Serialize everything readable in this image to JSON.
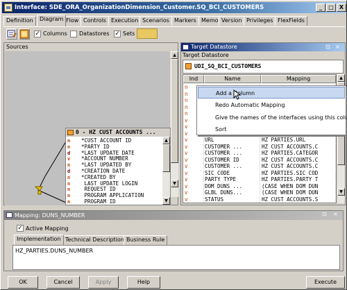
{
  "window": {
    "title": "Interface: SDE_ORA_OrganizationDimension_Customer.SQ_BCI_CUSTOMERS",
    "minimize_icon": "_",
    "maximize_icon": "□",
    "close_icon": "X"
  },
  "tabs": [
    "Definition",
    "Diagram",
    "Flow",
    "Controls",
    "Execution",
    "Scenarios",
    "Markers",
    "Memo",
    "Version",
    "Privileges",
    "FlexFields"
  ],
  "toolbar": {
    "columns_label": "Columns",
    "columns_checked": "✓",
    "datastores_label": "Datastores",
    "sets_label": "Sets",
    "sets_checked": "✓"
  },
  "sources": {
    "title": "Sources",
    "datastore_title": "0 - HZ CUST ACCOUNTS ...",
    "columns": [
      {
        "key": "n",
        "name": "*CUST ACCOUNT ID"
      },
      {
        "key": "n",
        "name": "*PARTY ID"
      },
      {
        "key": "d",
        "name": "*LAST UPDATE DATE"
      },
      {
        "key": "v",
        "name": "*ACCOUNT NUMBER"
      },
      {
        "key": "n",
        "name": "*LAST UPDATED BY"
      },
      {
        "key": "d",
        "name": "*CREATION DATE"
      },
      {
        "key": "n",
        "name": "*CREATED BY"
      },
      {
        "key": "n",
        "name": " LAST UPDATE LOGIN"
      },
      {
        "key": "n",
        "name": " REQUEST ID"
      },
      {
        "key": "n",
        "name": " PROGRAM APPLICATION"
      },
      {
        "key": "n",
        "name": " PROGRAM ID"
      }
    ]
  },
  "target": {
    "panel_title": "Target Datastore",
    "subtitle": "Target Datastore",
    "datastore_name": "UDI_SQ_BCI_CUSTOMERS",
    "headers": [
      "Ind",
      "Name",
      "Mapping"
    ],
    "rows": [
      {
        "ind": "n",
        "name": "",
        "mapping": ""
      },
      {
        "ind": "n",
        "name": "",
        "mapping": ""
      },
      {
        "ind": "n",
        "name": "",
        "mapping": ""
      },
      {
        "ind": "n",
        "name": "",
        "mapping": ""
      },
      {
        "ind": "n",
        "name": "",
        "mapping": ""
      },
      {
        "ind": "v",
        "name": "",
        "mapping": ""
      },
      {
        "ind": "v",
        "name": "",
        "mapping": ""
      },
      {
        "ind": "v",
        "name": "",
        "mapping": ""
      },
      {
        "ind": "v",
        "name": "URL",
        "mapping": "HZ PARTIES.URL"
      },
      {
        "ind": "v",
        "name": "CUSTOMER ...",
        "mapping": "HZ CUST ACCOUNTS.C"
      },
      {
        "ind": "v",
        "name": "CUSTOMER ...",
        "mapping": "HZ PARTIES.CATEGOR"
      },
      {
        "ind": "v",
        "name": "CUSTOMER ID",
        "mapping": "HZ CUST ACCOUNTS.C"
      },
      {
        "ind": "v",
        "name": "CUSTOMER ...",
        "mapping": "HZ CUST ACCOUNTS.C"
      },
      {
        "ind": "v",
        "name": "SIC CODE",
        "mapping": "HZ PARTIES.SIC COD"
      },
      {
        "ind": "v",
        "name": "PARTY TYPE",
        "mapping": "HZ PARTIES.PARTY T"
      },
      {
        "ind": "v",
        "name": "DOM DUNS ...",
        "mapping": "(CASE WHEN DOM DUN"
      },
      {
        "ind": "v",
        "name": "GLBL DUNS...",
        "mapping": "(CASE WHEN DOM DUN"
      },
      {
        "ind": "v",
        "name": "STATUS",
        "mapping": "HZ CUST ACCOUNTS.S"
      }
    ]
  },
  "context_menu": {
    "items": [
      "Add a Column",
      "Redo Automatic Mapping",
      "Give the names of the interfaces using this column",
      "Sort"
    ]
  },
  "mapping": {
    "title": "Mapping: DUNS_NUMBER",
    "active_label": "Active Mapping",
    "active_checked": "✓",
    "tabs": [
      "Implementation",
      "Technical Description",
      "Business Rule"
    ],
    "expression": "HZ_PARTIES.DUNS_NUMBER"
  },
  "buttons": {
    "ok": "OK",
    "cancel": "Cancel",
    "apply": "Apply",
    "help": "Help",
    "execute": "Execute"
  },
  "colors": {
    "title_start": "#0a246a",
    "title_end": "#a6caf0",
    "menu_highlight": "#c8d8f0"
  }
}
